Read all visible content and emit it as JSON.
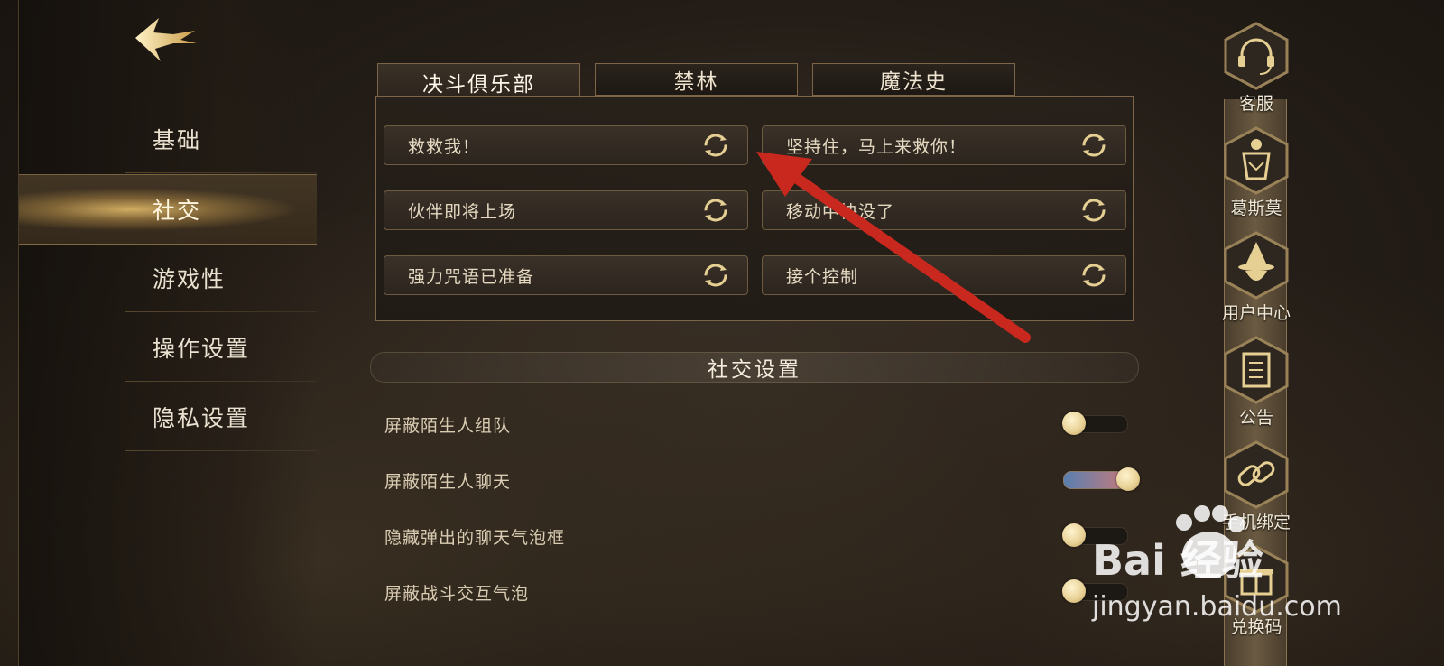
{
  "nav": {
    "items": [
      {
        "label": "基础"
      },
      {
        "label": "社交"
      },
      {
        "label": "游戏性"
      },
      {
        "label": "操作设置"
      },
      {
        "label": "隐私设置"
      }
    ],
    "active_index": 1
  },
  "tabs": [
    {
      "label": "决斗俱乐部",
      "active": true
    },
    {
      "label": "禁林",
      "active": false
    },
    {
      "label": "魔法史",
      "active": false
    }
  ],
  "quick_chat": [
    {
      "text": "救救我！"
    },
    {
      "text": "坚持住，马上来救你！"
    },
    {
      "text": "伙伴即将上场"
    },
    {
      "text": "移动中快没了"
    },
    {
      "text": "强力咒语已准备"
    },
    {
      "text": "接个控制"
    }
  ],
  "social_settings": {
    "title": "社交设置",
    "items": [
      {
        "label": "屏蔽陌生人组队",
        "enabled": false
      },
      {
        "label": "屏蔽陌生人聊天",
        "enabled": true
      },
      {
        "label": "隐藏弹出的聊天气泡框",
        "enabled": false
      },
      {
        "label": "屏蔽战斗交互气泡",
        "enabled": false
      }
    ]
  },
  "side_menu": [
    {
      "label": "客服",
      "icon": "headset-icon"
    },
    {
      "label": "葛斯莫",
      "icon": "gobstones-icon"
    },
    {
      "label": "用户中心",
      "icon": "wizard-hat-icon"
    },
    {
      "label": "公告",
      "icon": "scroll-icon"
    },
    {
      "label": "手机绑定",
      "icon": "chain-link-icon"
    },
    {
      "label": "兑换码",
      "icon": "gift-icon"
    }
  ],
  "watermark": {
    "brand": "Bai 经验",
    "url": "jingyan.baidu.com"
  },
  "colors": {
    "accent_gold": "#e6cf93",
    "toggle_on_start": "#5a7fb0",
    "toggle_on_end": "#c57a7a",
    "annotation_arrow": "#c8281e"
  }
}
